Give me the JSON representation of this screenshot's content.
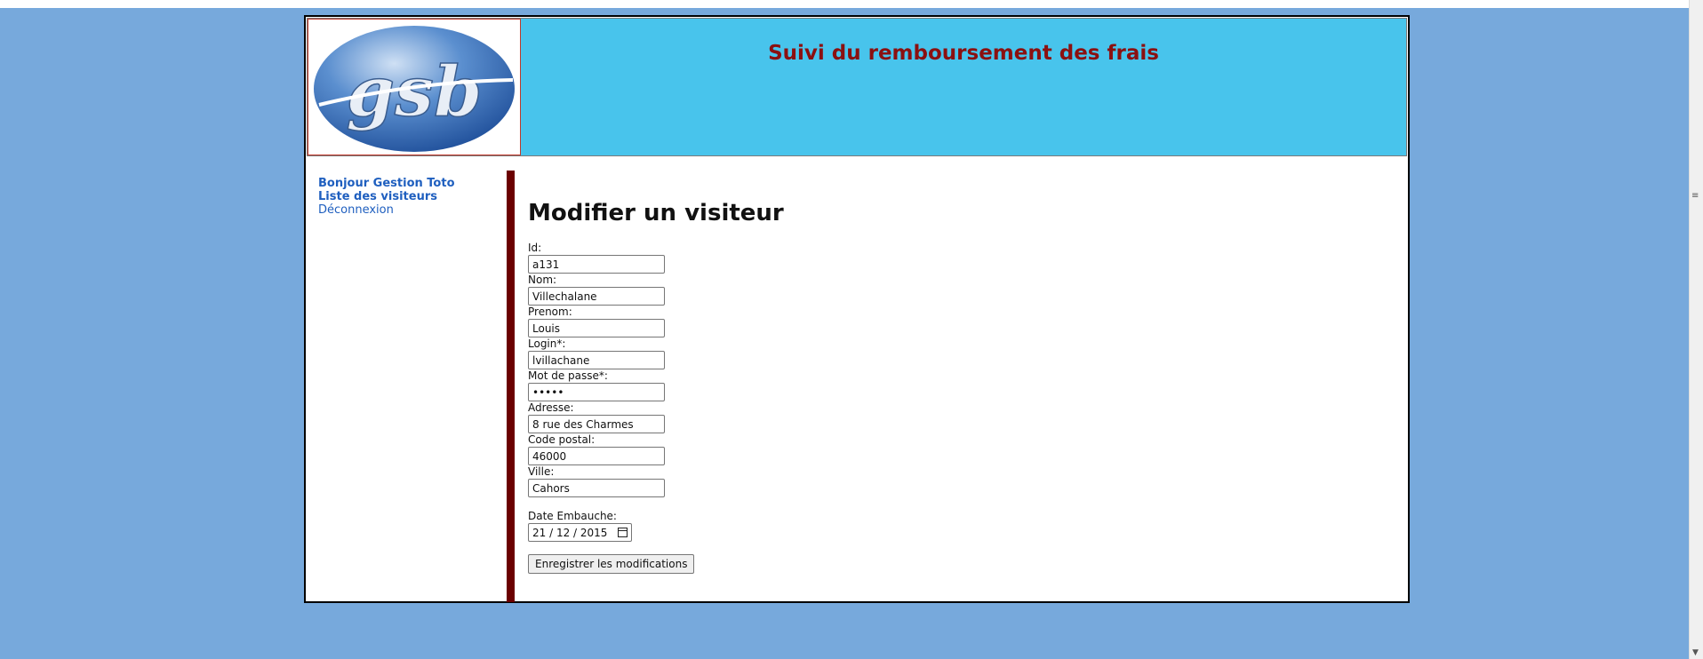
{
  "header": {
    "title": "Suivi du remboursement des frais",
    "logo_text": "gsb"
  },
  "sidebar": {
    "greeting": "Bonjour Gestion Toto",
    "visitors_link": "Liste des visiteurs",
    "logout_link": "Déconnexion"
  },
  "form": {
    "title": "Modifier un visiteur",
    "fields": {
      "id": {
        "label": "Id:",
        "value": "a131"
      },
      "nom": {
        "label": "Nom:",
        "value": "Villechalane"
      },
      "prenom": {
        "label": "Prenom:",
        "value": "Louis"
      },
      "login": {
        "label": "Login*:",
        "value": "lvillachane"
      },
      "password": {
        "label": "Mot de passe*:",
        "value": "•••••"
      },
      "adresse": {
        "label": "Adresse:",
        "value": "8 rue des Charmes"
      },
      "code_postal": {
        "label": "Code postal:",
        "value": "46000"
      },
      "ville": {
        "label": "Ville:",
        "value": "Cahors"
      },
      "date_embauche": {
        "label": "Date Embauche:",
        "value": "21 / 12 / 2015"
      }
    },
    "submit_label": "Enregistrer les modifications"
  },
  "colors": {
    "page_background": "#77a9dc",
    "header_background": "#48c4ec",
    "header_title": "#8b1010",
    "sidebar_link": "#1f5fbf",
    "divider": "#6b0000"
  },
  "icons": {
    "date_picker": "calendar-icon",
    "scroll_grip": "scroll-grip-icon",
    "scroll_down": "chevron-down-icon"
  }
}
